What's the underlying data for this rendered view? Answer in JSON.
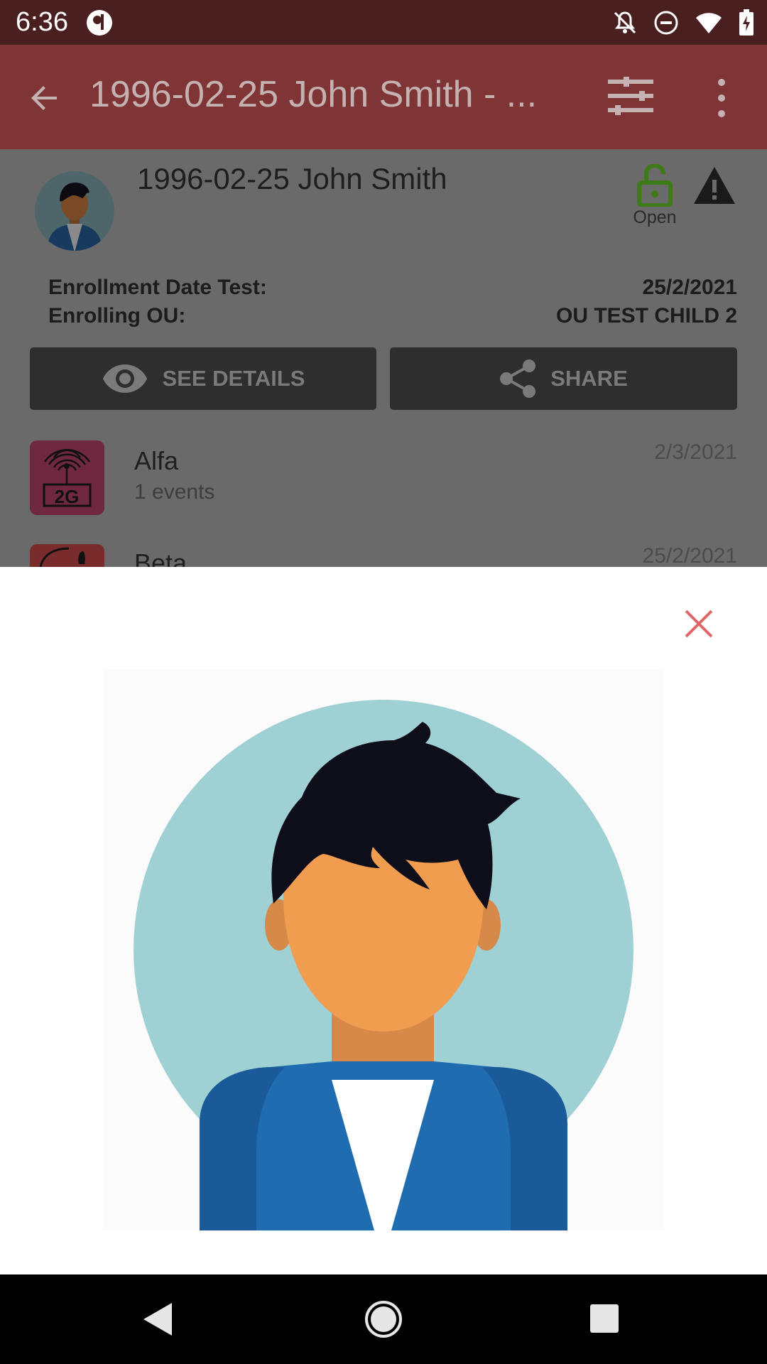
{
  "status_bar": {
    "time": "6:36",
    "icons": [
      "app-notification-icon",
      "notifications-off-icon",
      "do-not-disturb-icon",
      "wifi-icon",
      "battery-charging-icon"
    ]
  },
  "app_bar": {
    "title": "1996-02-25 John Smith - ...",
    "icons": [
      "back-arrow-icon",
      "filter-icon",
      "more-vert-icon"
    ],
    "background_color": "#7f3535"
  },
  "tei": {
    "name": "1996-02-25 John Smith",
    "lock_status": "Open",
    "lock_color": "#4a8a1f"
  },
  "enrollment": {
    "date_label": "Enrollment Date Test:",
    "date_value": "25/2/2021",
    "ou_label": "Enrolling OU:",
    "ou_value": "OU TEST CHILD 2"
  },
  "actions": {
    "see_details": "SEE DETAILS",
    "share": "SHARE"
  },
  "stages": [
    {
      "name": "Alfa",
      "subtitle": "1 events",
      "date": "2/3/2021",
      "icon_text": "2G"
    },
    {
      "name": "Beta",
      "date": "25/2/2021"
    }
  ],
  "dialog": {
    "close_color": "#e06767",
    "image": "profile-avatar"
  },
  "nav_bar": {
    "icons": [
      "nav-back-icon",
      "nav-home-icon",
      "nav-recents-icon"
    ]
  }
}
